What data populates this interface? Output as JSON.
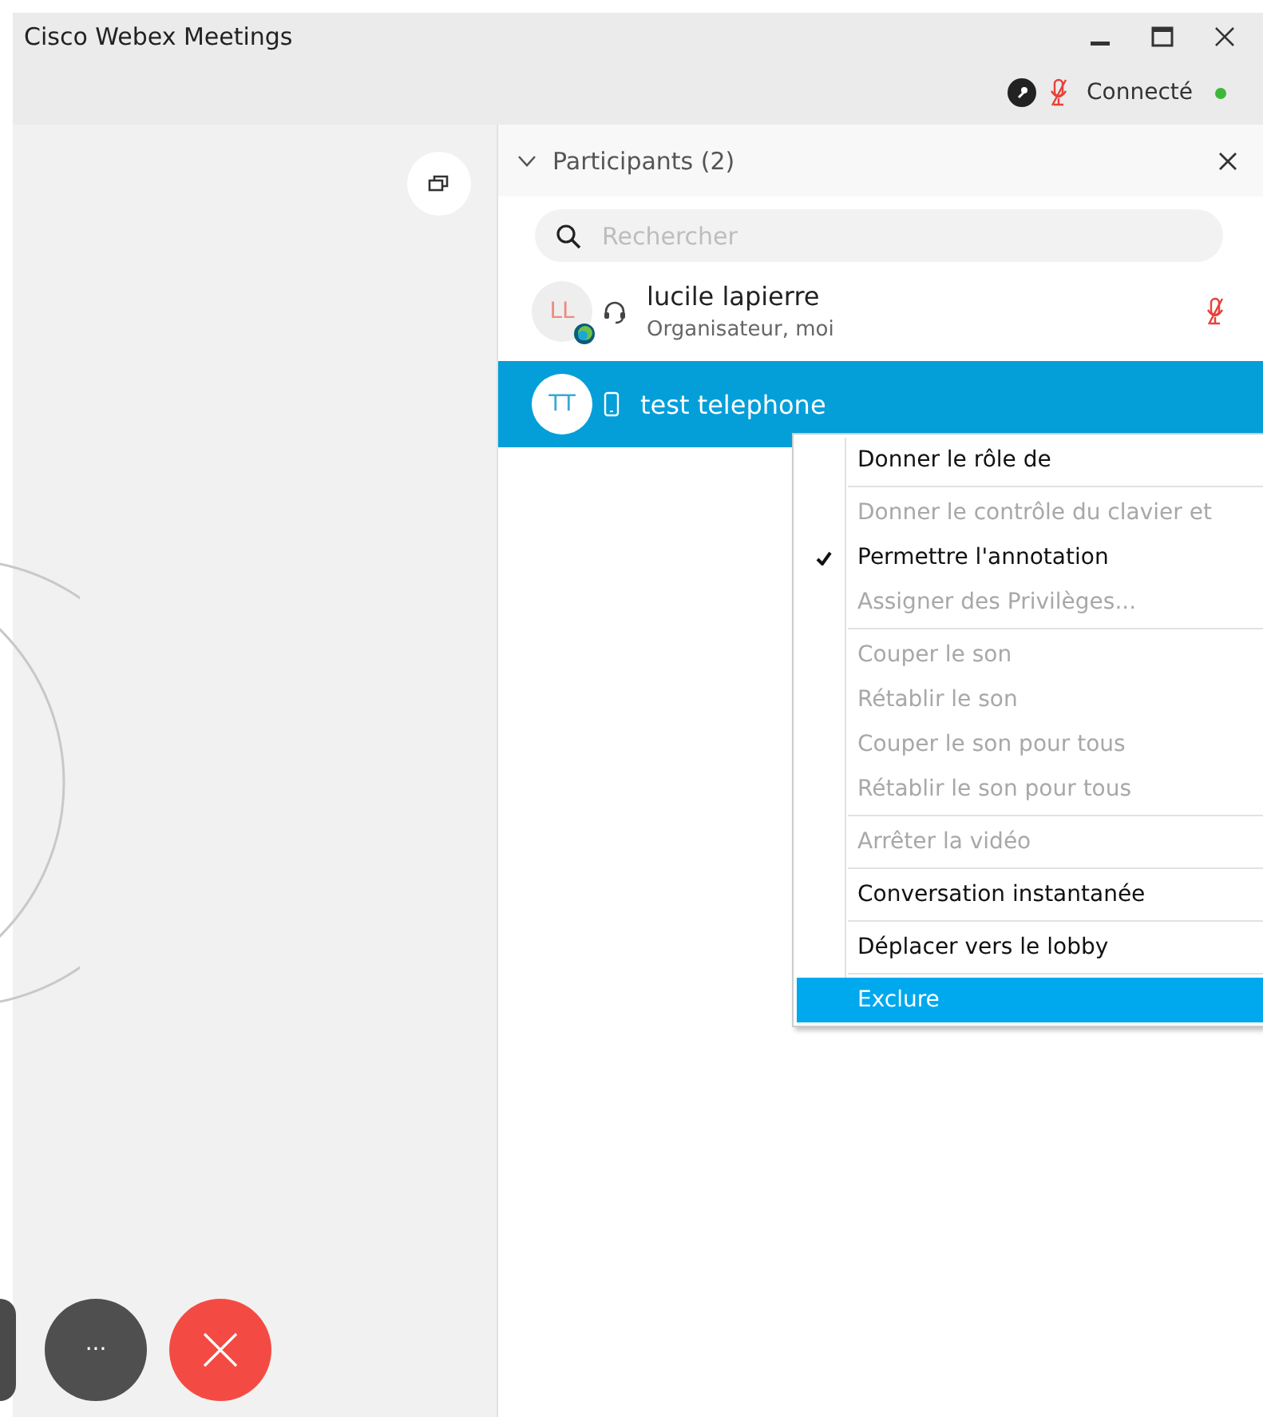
{
  "window": {
    "title": "Cisco Webex Meetings"
  },
  "status": {
    "label": "Connecté",
    "mic_muted": true,
    "connected": true
  },
  "participants_panel": {
    "title": "Participants (2)",
    "expanded": true,
    "search": {
      "placeholder": "Rechercher"
    },
    "participants": [
      {
        "initials": "LL",
        "name": "lucile lapierre",
        "role": "Organisateur, moi",
        "kind": "headset",
        "host": true,
        "mic_muted": true,
        "selected": false
      },
      {
        "initials": "TT",
        "name": "test telephone",
        "kind": "phone",
        "host": false,
        "mic_muted": false,
        "selected": true
      }
    ]
  },
  "context_menu": {
    "groups": [
      [
        {
          "label": "Donner le rôle de",
          "disabled": false,
          "checked": false,
          "selected": false
        }
      ],
      [
        {
          "label": "Donner le contrôle du clavier et",
          "disabled": true,
          "checked": false,
          "selected": false
        },
        {
          "label": "Permettre l'annotation",
          "disabled": false,
          "checked": true,
          "selected": false
        },
        {
          "label": "Assigner des Privilèges...",
          "disabled": true,
          "checked": false,
          "selected": false
        }
      ],
      [
        {
          "label": "Couper le son",
          "disabled": true,
          "checked": false,
          "selected": false
        },
        {
          "label": "Rétablir le son",
          "disabled": true,
          "checked": false,
          "selected": false
        },
        {
          "label": "Couper le son pour tous",
          "disabled": true,
          "checked": false,
          "selected": false
        },
        {
          "label": "Rétablir le son pour tous",
          "disabled": true,
          "checked": false,
          "selected": false
        }
      ],
      [
        {
          "label": "Arrêter la vidéo",
          "disabled": true,
          "checked": false,
          "selected": false
        }
      ],
      [
        {
          "label": "Conversation instantanée",
          "disabled": false,
          "checked": false,
          "selected": false
        }
      ],
      [
        {
          "label": "Déplacer vers le lobby",
          "disabled": false,
          "checked": false,
          "selected": false
        }
      ],
      [
        {
          "label": "Exclure",
          "disabled": false,
          "checked": false,
          "selected": true
        }
      ]
    ]
  },
  "controls": {
    "more_label": "···"
  }
}
